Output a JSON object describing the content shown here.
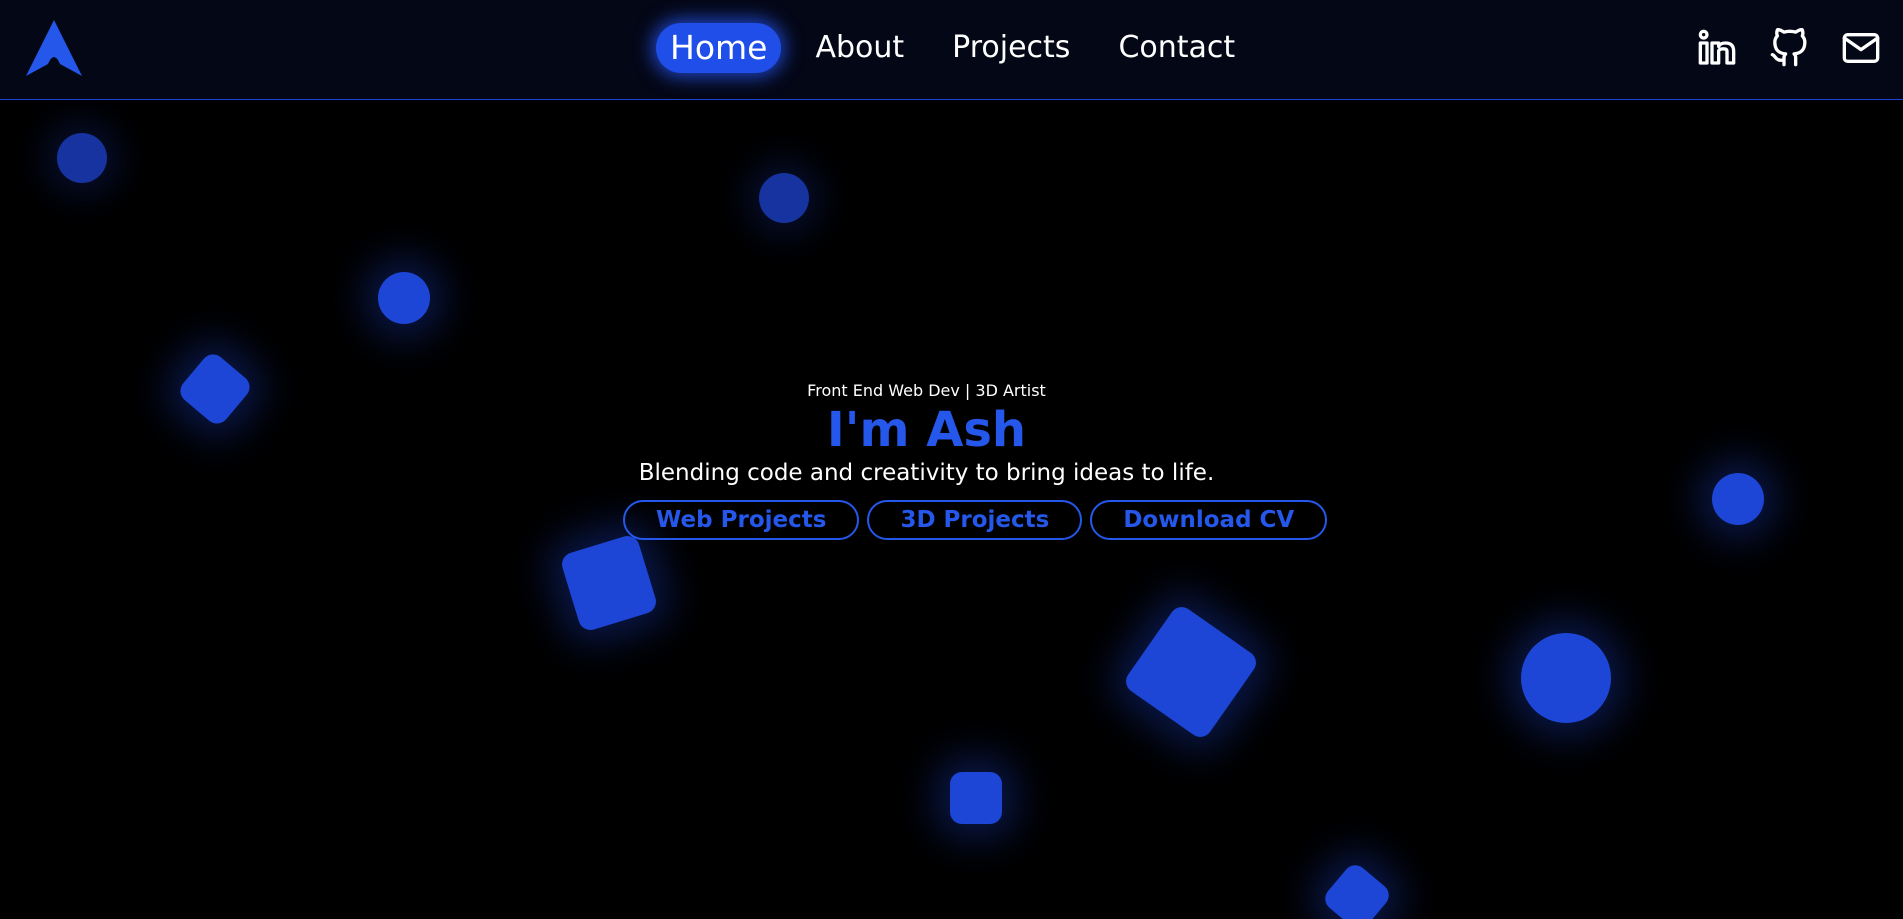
{
  "nav": {
    "logo_icon": "triangle-a-logo-icon",
    "links": [
      {
        "label": "Home",
        "active": true
      },
      {
        "label": "About",
        "active": false
      },
      {
        "label": "Projects",
        "active": false
      },
      {
        "label": "Contact",
        "active": false
      }
    ],
    "social_icons": [
      "linkedin-icon",
      "github-icon",
      "mail-icon"
    ]
  },
  "hero": {
    "tagline": "Front End Web Dev | 3D Artist",
    "title": "I'm Ash",
    "subtitle": "Blending code and creativity to bring ideas to life.",
    "buttons": [
      {
        "label": "Web Projects"
      },
      {
        "label": "3D Projects"
      },
      {
        "label": "Download CV"
      }
    ]
  },
  "colors": {
    "accent": "#2457ea",
    "nav_background": "#040716",
    "page_background": "#000000",
    "text": "#ffffff"
  }
}
